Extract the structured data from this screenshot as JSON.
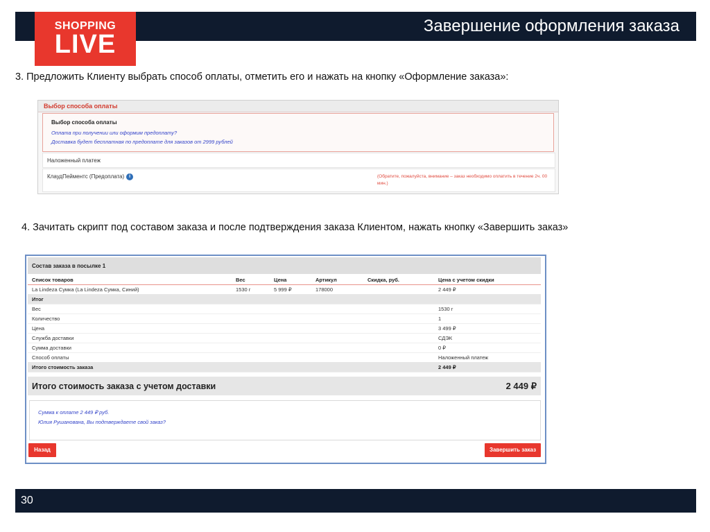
{
  "header": {
    "title": "Завершение оформления заказа"
  },
  "logo": {
    "line1": "SHOPPING",
    "line2": "LIVE"
  },
  "step3": "3. Предложить Клиенту выбрать способ оплаты, отметить его и нажать на кнопку «Оформление заказа»:",
  "payment": {
    "header": "Выбор способа оплаты",
    "section_title": "Выбор способа оплаты",
    "note1": "Оплата при получении или оформим предоплату?",
    "note2": "Доставка будет бесплатная по предоплате для заказов от 2999 рублей",
    "option1": "Наложенный платеж",
    "option2": "КлаудПейментс (Предоплата)",
    "info_icon": "i",
    "warning": "(Обратите, пожалуйста, внимание – заказ необходимо оплатить в течение 2ч. 00 мин.)"
  },
  "step4": "4. Зачитать скрипт под составом заказа и после подтверждения заказа Клиентом, нажать кнопку «Завершить заказ»",
  "order": {
    "title": "Состав заказа в посылке 1",
    "columns": [
      "Список товаров",
      "Вес",
      "Цена",
      "Артикул",
      "Скидка, руб.",
      "Цена с учетом скидки"
    ],
    "item": [
      "La Lindeza Сумка (La Lindeza Сумка, Синий)",
      "1530 г",
      "5 999 ₽",
      "178000",
      "",
      "2 449 ₽"
    ],
    "summary_title": "Итог",
    "summary": [
      {
        "label": "Вес",
        "value": "1530 г"
      },
      {
        "label": "Количество",
        "value": "1"
      },
      {
        "label": "Цена",
        "value": "3 499 ₽"
      },
      {
        "label": "Служба доставки",
        "value": "СДЭК"
      },
      {
        "label": "Сумма доставки",
        "value": "0 ₽"
      },
      {
        "label": "Способ оплаты",
        "value": "Наложенный платеж"
      }
    ],
    "total_label": "Итого стоимость заказа",
    "total_value": "2 449 ₽",
    "grand_label": "Итого стоимость заказа с учетом доставки",
    "grand_value": "2 449 ₽",
    "confirm1": "Сумма к оплате 2 449 ₽ руб.",
    "confirm2": "Юлия Рушанована, Вы подтверждаете свой заказ?",
    "back_button": "Назад",
    "finish_button": "Завершить заказ"
  },
  "footer": {
    "page_number": "30"
  },
  "colors": {
    "accent": "#e8372d",
    "navy": "#0f1b2e",
    "link": "#3444c9"
  }
}
